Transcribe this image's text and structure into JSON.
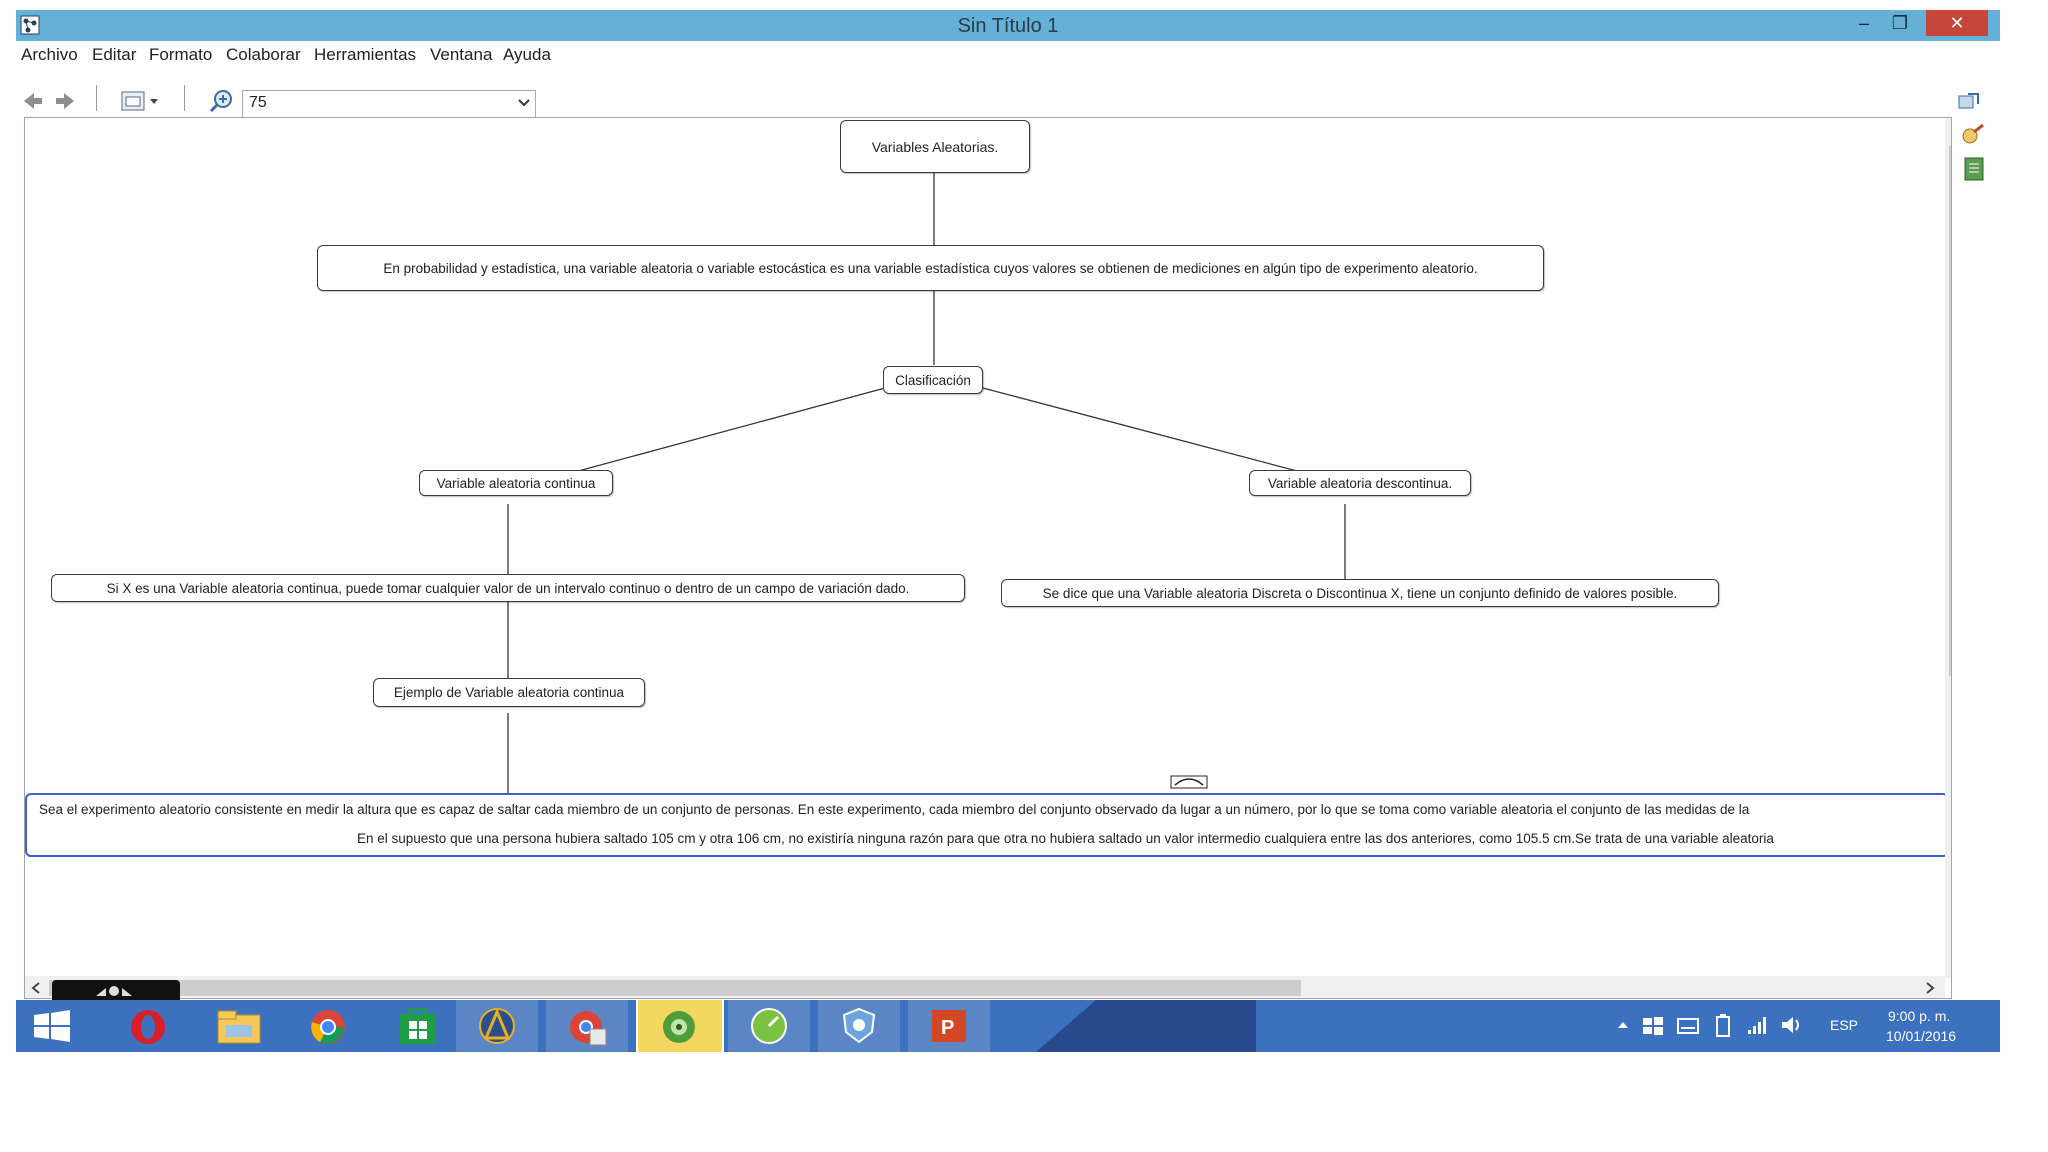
{
  "window": {
    "title": "Sin Título 1",
    "minimize": "–",
    "maximize": "❐",
    "close": "✕"
  },
  "menu": [
    "Archivo",
    "Editar",
    "Formato",
    "Colaborar",
    "Herramientas",
    "Ventana",
    "Ayuda"
  ],
  "toolbar": {
    "zoom_value": "75",
    "back_icon": "arrow-left-icon",
    "forward_icon": "arrow-right-icon",
    "view_icon": "view-options-icon",
    "zoom_icon": "zoom-icon"
  },
  "map": {
    "root": "Variables Aleatorias.",
    "definition": "En probabilidad y estadística, una variable aleatoria o variable estocástica es una variable estadística cuyos valores se obtienen de mediciones en algún tipo de experimento aleatorio.",
    "classification": "Clasificación",
    "continuous": "Variable aleatoria continua",
    "discrete": "Variable aleatoria descontinua.",
    "continuous_def": "Si X es una Variable aleatoria continua, puede tomar cualquier valor de un intervalo continuo o dentro de un campo de variación dado.",
    "discrete_def": "Se dice que una Variable aleatoria Discreta o Discontinua X, tiene un conjunto definido de valores posible.",
    "example_label": "Ejemplo de Variable aleatoria continua",
    "example_line1": "Sea el experimento aleatorio consistente en medir la altura que es capaz de saltar cada miembro de un conjunto de personas. En este experimento, cada miembro del conjunto observado da lugar a un número, por lo que se toma como variable aleatoria el conjunto de las medidas de la",
    "example_line2": "En el supuesto que una persona hubiera saltado 105 cm y otra 106 cm, no existiría ninguna razón para que otra no hubiera saltado un valor intermedio cualquiera entre las dos anteriores, como 105.5 cm.Se trata de una variable aleatoria"
  },
  "taskbar": {
    "apps": [
      "windows-start-icon",
      "opera-icon",
      "file-explorer-icon",
      "chrome-icon",
      "store-icon",
      "arcgis-icon",
      "chrome-apps-icon",
      "cmaptools-icon",
      "speed-icon",
      "security-icon",
      "powerpoint-icon"
    ],
    "language": "ESP",
    "time": "9:00 p. m.",
    "date": "10/01/2016"
  },
  "colors": {
    "titlebar": "#64b0d6",
    "close": "#c7463a",
    "taskbar": "#3c71c0",
    "selection": "#3e5cd0"
  }
}
